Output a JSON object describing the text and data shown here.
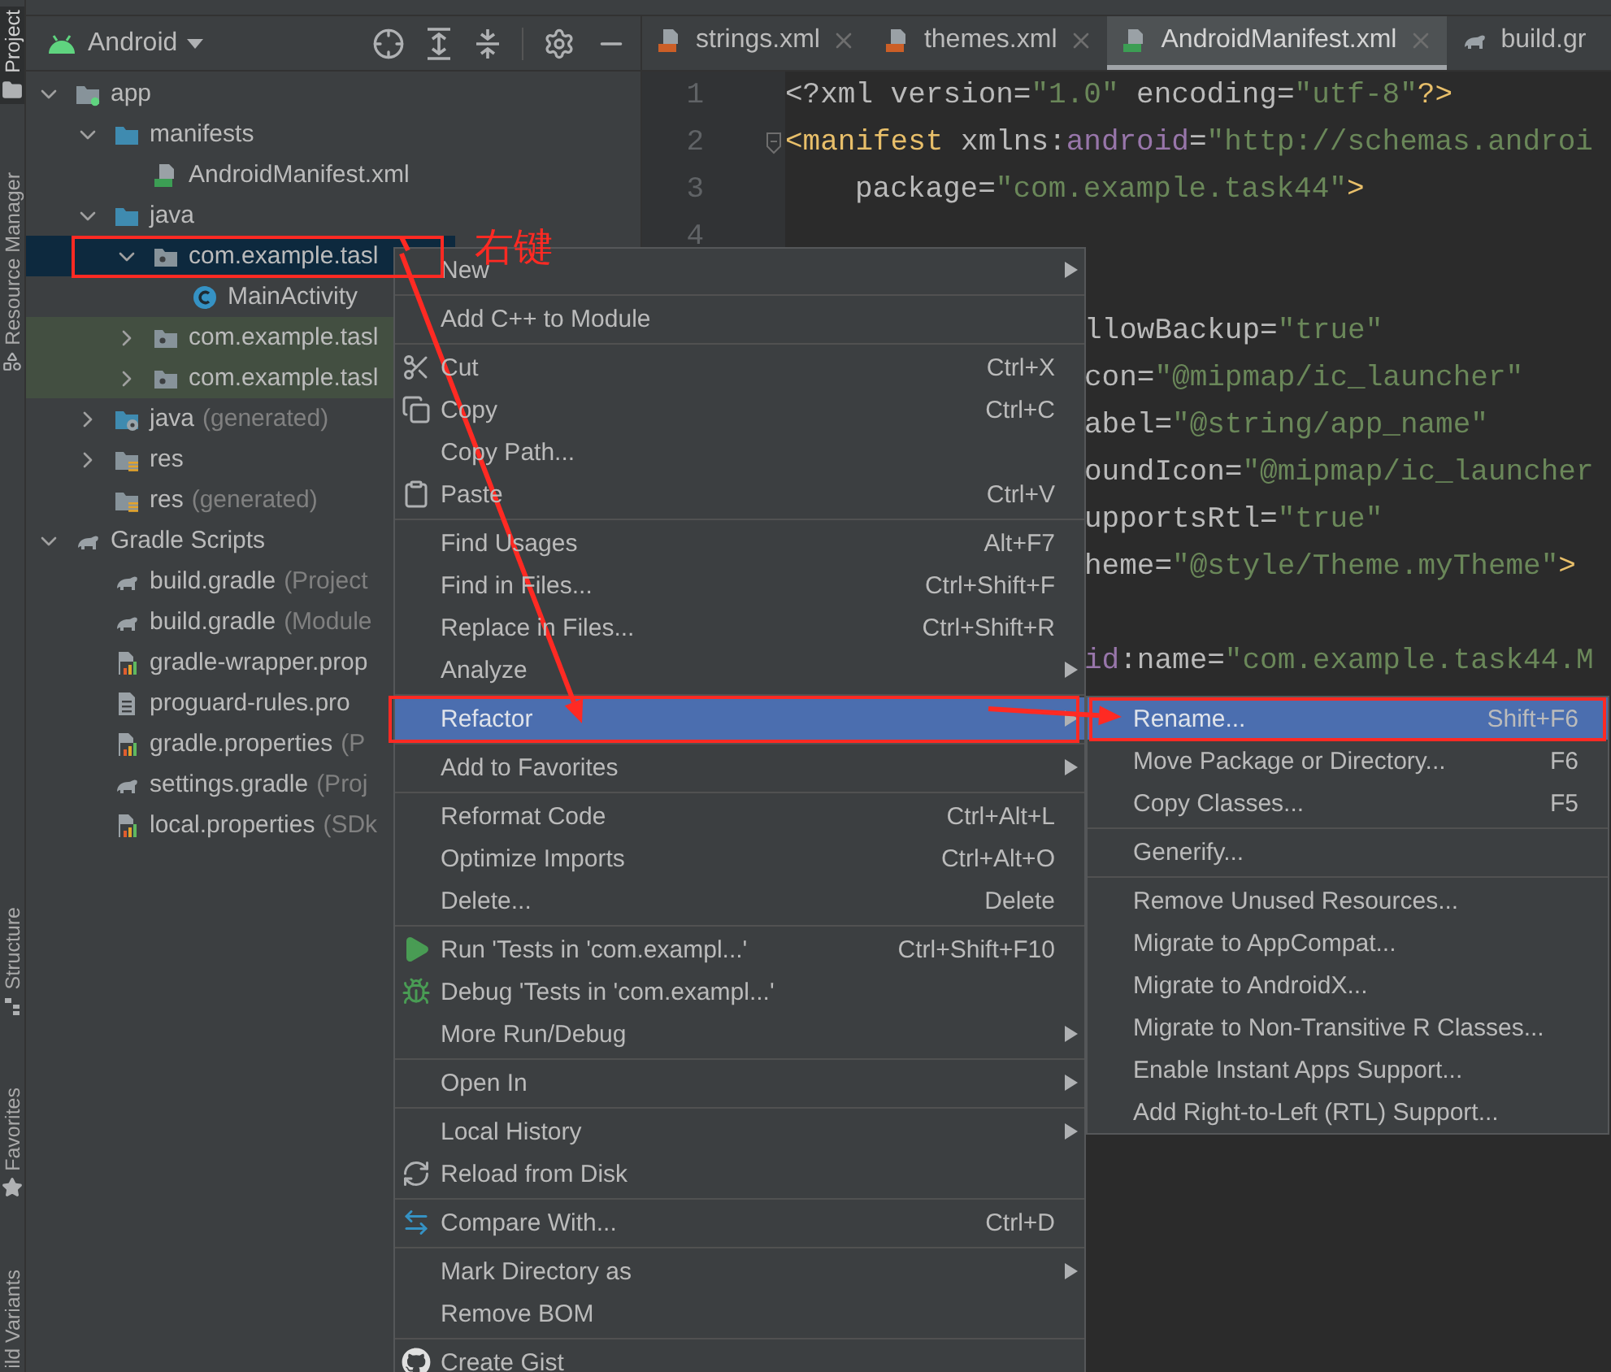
{
  "tool_strip": {
    "top": [
      {
        "label": "Project",
        "kind": "folder",
        "selected": true
      },
      {
        "label": "Resource Manager",
        "kind": "shapes",
        "selected": false
      }
    ],
    "bottom": [
      {
        "label": "Structure",
        "kind": "structure",
        "selected": false
      },
      {
        "label": "Favorites",
        "kind": "star",
        "selected": false
      },
      {
        "label": "ild Variants",
        "kind": "plain",
        "selected": false
      }
    ]
  },
  "project": {
    "view": "Android",
    "tree": [
      {
        "label": "app",
        "kind": "module",
        "expanded": true,
        "selected": false,
        "tinted": false,
        "children": [
          {
            "label": "manifests",
            "kind": "source-folder",
            "expanded": true,
            "selected": false,
            "tinted": false,
            "children": [
              {
                "label": "AndroidManifest.xml",
                "kind": "manifest",
                "selected": false,
                "tinted": false
              }
            ]
          },
          {
            "label": "java",
            "kind": "source-folder",
            "expanded": true,
            "selected": false,
            "tinted": false,
            "children": [
              {
                "label": "com.example.tasl",
                "kind": "package",
                "expanded": true,
                "selected": true,
                "tinted": false,
                "children": [
                  {
                    "label": "MainActivity",
                    "kind": "class",
                    "selected": false,
                    "tinted": false
                  }
                ]
              },
              {
                "label": "com.example.tasl",
                "kind": "package",
                "expanded": false,
                "selected": false,
                "tinted": true
              },
              {
                "label": "com.example.tasl",
                "kind": "package",
                "expanded": false,
                "selected": false,
                "tinted": true
              }
            ]
          },
          {
            "label": "java",
            "suffix": "(generated)",
            "kind": "generated-folder",
            "expanded": false,
            "selected": false,
            "tinted": false
          },
          {
            "label": "res",
            "kind": "res-folder",
            "expanded": false,
            "selected": false,
            "tinted": false
          },
          {
            "label": "res",
            "suffix": "(generated)",
            "kind": "res-folder",
            "selected": false,
            "tinted": false
          }
        ]
      },
      {
        "label": "Gradle Scripts",
        "kind": "gradle",
        "expanded": true,
        "selected": false,
        "tinted": false,
        "children": [
          {
            "label": "build.gradle",
            "suffix": "(Project",
            "kind": "gradle",
            "selected": false,
            "tinted": false
          },
          {
            "label": "build.gradle",
            "suffix": "(Module",
            "kind": "gradle",
            "selected": false,
            "tinted": false
          },
          {
            "label": "gradle-wrapper.prop",
            "kind": "props",
            "selected": false,
            "tinted": false
          },
          {
            "label": "proguard-rules.pro",
            "kind": "file",
            "selected": false,
            "tinted": false
          },
          {
            "label": "gradle.properties",
            "suffix": "(P",
            "kind": "props",
            "selected": false,
            "tinted": false
          },
          {
            "label": "settings.gradle",
            "suffix": "(Proj",
            "kind": "gradle",
            "selected": false,
            "tinted": false
          },
          {
            "label": "local.properties",
            "suffix": "(SDk",
            "kind": "props",
            "selected": false,
            "tinted": false
          }
        ]
      }
    ]
  },
  "tabs": [
    {
      "label": "strings.xml",
      "kind": "xml",
      "selected": false,
      "closable": true
    },
    {
      "label": "themes.xml",
      "kind": "xml",
      "selected": false,
      "closable": true
    },
    {
      "label": "AndroidManifest.xml",
      "kind": "manifest",
      "selected": true,
      "closable": true
    },
    {
      "label": "build.gr",
      "kind": "gradle",
      "selected": false,
      "closable": false
    }
  ],
  "editor": {
    "lines": [
      {
        "kind": "plain",
        "number": "1",
        "segments": [
          {
            "kind": "attr",
            "text": "<?xml version="
          },
          {
            "kind": "value",
            "text": "\"1.0\""
          },
          {
            "kind": "attr",
            "text": " encoding="
          },
          {
            "kind": "value",
            "text": "\"utf-8\""
          },
          {
            "kind": "tag",
            "text": "?>"
          }
        ]
      },
      {
        "kind": "plain",
        "number": "2",
        "fold": true,
        "segments": [
          {
            "kind": "tag",
            "text": "<manifest"
          },
          {
            "kind": "attr",
            "text": " xmlns:"
          },
          {
            "kind": "ns",
            "text": "android"
          },
          {
            "kind": "attr",
            "text": "="
          },
          {
            "kind": "value",
            "text": "\"http://schemas.androi"
          }
        ]
      },
      {
        "kind": "continued",
        "number": "3",
        "segments": [
          {
            "kind": "attr",
            "text": "package="
          },
          {
            "kind": "value",
            "text": "\"com.example.task44\""
          },
          {
            "kind": "tag",
            "text": ">"
          }
        ]
      },
      {
        "kind": "plain",
        "number": "4"
      },
      {
        "kind": "blank"
      },
      {
        "kind": "clipped",
        "segments": [
          {
            "kind": "attr",
            "text": "llowBackup="
          },
          {
            "kind": "value",
            "text": "\"true\""
          }
        ]
      },
      {
        "kind": "clipped",
        "segments": [
          {
            "kind": "attr",
            "text": "con="
          },
          {
            "kind": "value",
            "text": "\"@mipmap/ic_launcher\""
          }
        ]
      },
      {
        "kind": "clipped",
        "segments": [
          {
            "kind": "attr",
            "text": "abel="
          },
          {
            "kind": "value",
            "text": "\"@string/app_name\""
          }
        ]
      },
      {
        "kind": "clipped",
        "segments": [
          {
            "kind": "attr",
            "text": "oundIcon="
          },
          {
            "kind": "value",
            "text": "\"@mipmap/ic_launcher"
          }
        ]
      },
      {
        "kind": "clipped",
        "segments": [
          {
            "kind": "attr",
            "text": "upportsRtl="
          },
          {
            "kind": "value",
            "text": "\"true\""
          }
        ]
      },
      {
        "kind": "clipped",
        "segments": [
          {
            "kind": "attr",
            "text": "heme="
          },
          {
            "kind": "value",
            "text": "\"@style/Theme.myTheme\""
          },
          {
            "kind": "tag",
            "text": ">"
          }
        ]
      },
      {
        "kind": "blank"
      },
      {
        "kind": "clipped",
        "segments": [
          {
            "kind": "ns",
            "text": "id"
          },
          {
            "kind": "attr",
            "text": ":name="
          },
          {
            "kind": "value",
            "text": "\"com.example.task44.M"
          }
        ]
      }
    ]
  },
  "context_menu": {
    "items": [
      {
        "kind": "plain",
        "label": "New",
        "submenu": true,
        "selected": false
      },
      {
        "kind": "separator"
      },
      {
        "kind": "plain",
        "label": "Add C++ to Module",
        "submenu": false,
        "selected": false
      },
      {
        "kind": "separator"
      },
      {
        "kind": "cut",
        "label": "Cut",
        "shortcut": "Ctrl+X",
        "submenu": false,
        "selected": false
      },
      {
        "kind": "copy",
        "label": "Copy",
        "shortcut": "Ctrl+C",
        "submenu": false,
        "selected": false
      },
      {
        "kind": "plain",
        "label": "Copy Path...",
        "submenu": false,
        "selected": false
      },
      {
        "kind": "paste",
        "label": "Paste",
        "shortcut": "Ctrl+V",
        "submenu": false,
        "selected": false
      },
      {
        "kind": "separator"
      },
      {
        "kind": "plain",
        "label": "Find Usages",
        "shortcut": "Alt+F7",
        "submenu": false,
        "selected": false
      },
      {
        "kind": "plain",
        "label": "Find in Files...",
        "shortcut": "Ctrl+Shift+F",
        "submenu": false,
        "selected": false
      },
      {
        "kind": "plain",
        "label": "Replace in Files...",
        "shortcut": "Ctrl+Shift+R",
        "submenu": false,
        "selected": false
      },
      {
        "kind": "plain",
        "label": "Analyze",
        "submenu": true,
        "selected": false
      },
      {
        "kind": "separator"
      },
      {
        "kind": "plain",
        "label": "Refactor",
        "submenu": true,
        "selected": true
      },
      {
        "kind": "separator"
      },
      {
        "kind": "plain",
        "label": "Add to Favorites",
        "submenu": true,
        "selected": false
      },
      {
        "kind": "separator"
      },
      {
        "kind": "plain",
        "label": "Reformat Code",
        "shortcut": "Ctrl+Alt+L",
        "submenu": false,
        "selected": false
      },
      {
        "kind": "plain",
        "label": "Optimize Imports",
        "shortcut": "Ctrl+Alt+O",
        "submenu": false,
        "selected": false
      },
      {
        "kind": "plain",
        "label": "Delete...",
        "shortcut": "Delete",
        "submenu": false,
        "selected": false
      },
      {
        "kind": "separator"
      },
      {
        "kind": "run",
        "label": "Run 'Tests in 'com.exampl...'",
        "shortcut": "Ctrl+Shift+F10",
        "submenu": false,
        "selected": false
      },
      {
        "kind": "debug",
        "label": "Debug 'Tests in 'com.exampl...'",
        "submenu": false,
        "selected": false
      },
      {
        "kind": "plain",
        "label": "More Run/Debug",
        "submenu": true,
        "selected": false
      },
      {
        "kind": "separator"
      },
      {
        "kind": "plain",
        "label": "Open In",
        "submenu": true,
        "selected": false
      },
      {
        "kind": "separator"
      },
      {
        "kind": "plain",
        "label": "Local History",
        "submenu": true,
        "selected": false
      },
      {
        "kind": "reload",
        "label": "Reload from Disk",
        "submenu": false,
        "selected": false
      },
      {
        "kind": "separator"
      },
      {
        "kind": "compare",
        "label": "Compare With...",
        "shortcut": "Ctrl+D",
        "submenu": false,
        "selected": false
      },
      {
        "kind": "separator"
      },
      {
        "kind": "plain",
        "label": "Mark Directory as",
        "submenu": true,
        "selected": false
      },
      {
        "kind": "plain",
        "label": "Remove BOM",
        "submenu": false,
        "selected": false
      },
      {
        "kind": "separator"
      },
      {
        "kind": "gist",
        "label": "Create Gist",
        "submenu": false,
        "selected": false
      }
    ]
  },
  "refactor_submenu": {
    "items": [
      {
        "kind": "plain",
        "label": "Rename...",
        "shortcut": "Shift+F6",
        "selected": true
      },
      {
        "kind": "plain",
        "label": "Move Package or Directory...",
        "shortcut": "F6",
        "selected": false
      },
      {
        "kind": "plain",
        "label": "Copy Classes...",
        "shortcut": "F5",
        "selected": false
      },
      {
        "kind": "separator"
      },
      {
        "kind": "plain",
        "label": "Generify...",
        "selected": false
      },
      {
        "kind": "separator"
      },
      {
        "kind": "plain",
        "label": "Remove Unused Resources...",
        "selected": false
      },
      {
        "kind": "plain",
        "label": "Migrate to AppCompat...",
        "selected": false
      },
      {
        "kind": "plain",
        "label": "Migrate to AndroidX...",
        "selected": false
      },
      {
        "kind": "plain",
        "label": "Migrate to Non-Transitive R Classes...",
        "selected": false
      },
      {
        "kind": "plain",
        "label": "Enable Instant Apps Support...",
        "selected": false
      },
      {
        "kind": "plain",
        "label": "Add Right-to-Left (RTL) Support...",
        "selected": false
      }
    ]
  },
  "annotation": {
    "label": "右键"
  }
}
